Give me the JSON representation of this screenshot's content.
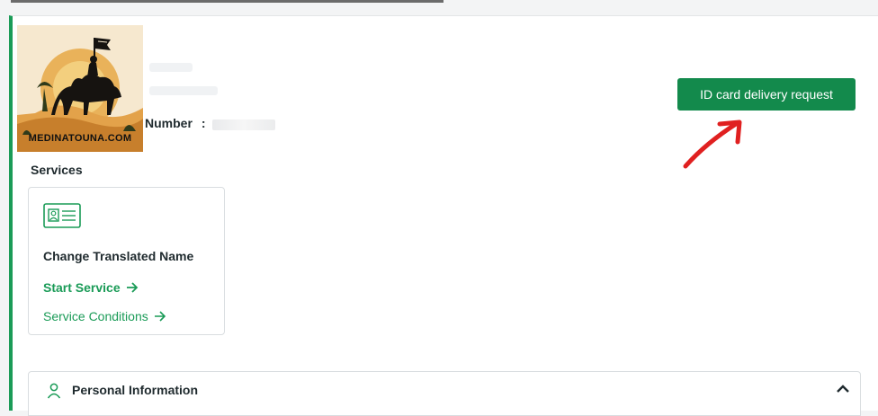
{
  "logo": {
    "text": "MEDINATOUNA.COM",
    "icon": "camel-rider-logo"
  },
  "profile": {
    "number_label": "Number",
    "number_separator": ":"
  },
  "actions": {
    "id_card_delivery": "ID card delivery request"
  },
  "services": {
    "title": "Services",
    "items": [
      {
        "name": "Change Translated Name",
        "icon": "id-card-icon",
        "start_label": "Start Service",
        "conditions_label": "Service Conditions"
      }
    ]
  },
  "personal_info": {
    "title": "Personal Information",
    "icon": "person-icon",
    "toggle_icon": "chevron-up-icon"
  },
  "colors": {
    "accent": "#138a4c",
    "link": "#1a9b57",
    "annotation": "#e02020"
  }
}
